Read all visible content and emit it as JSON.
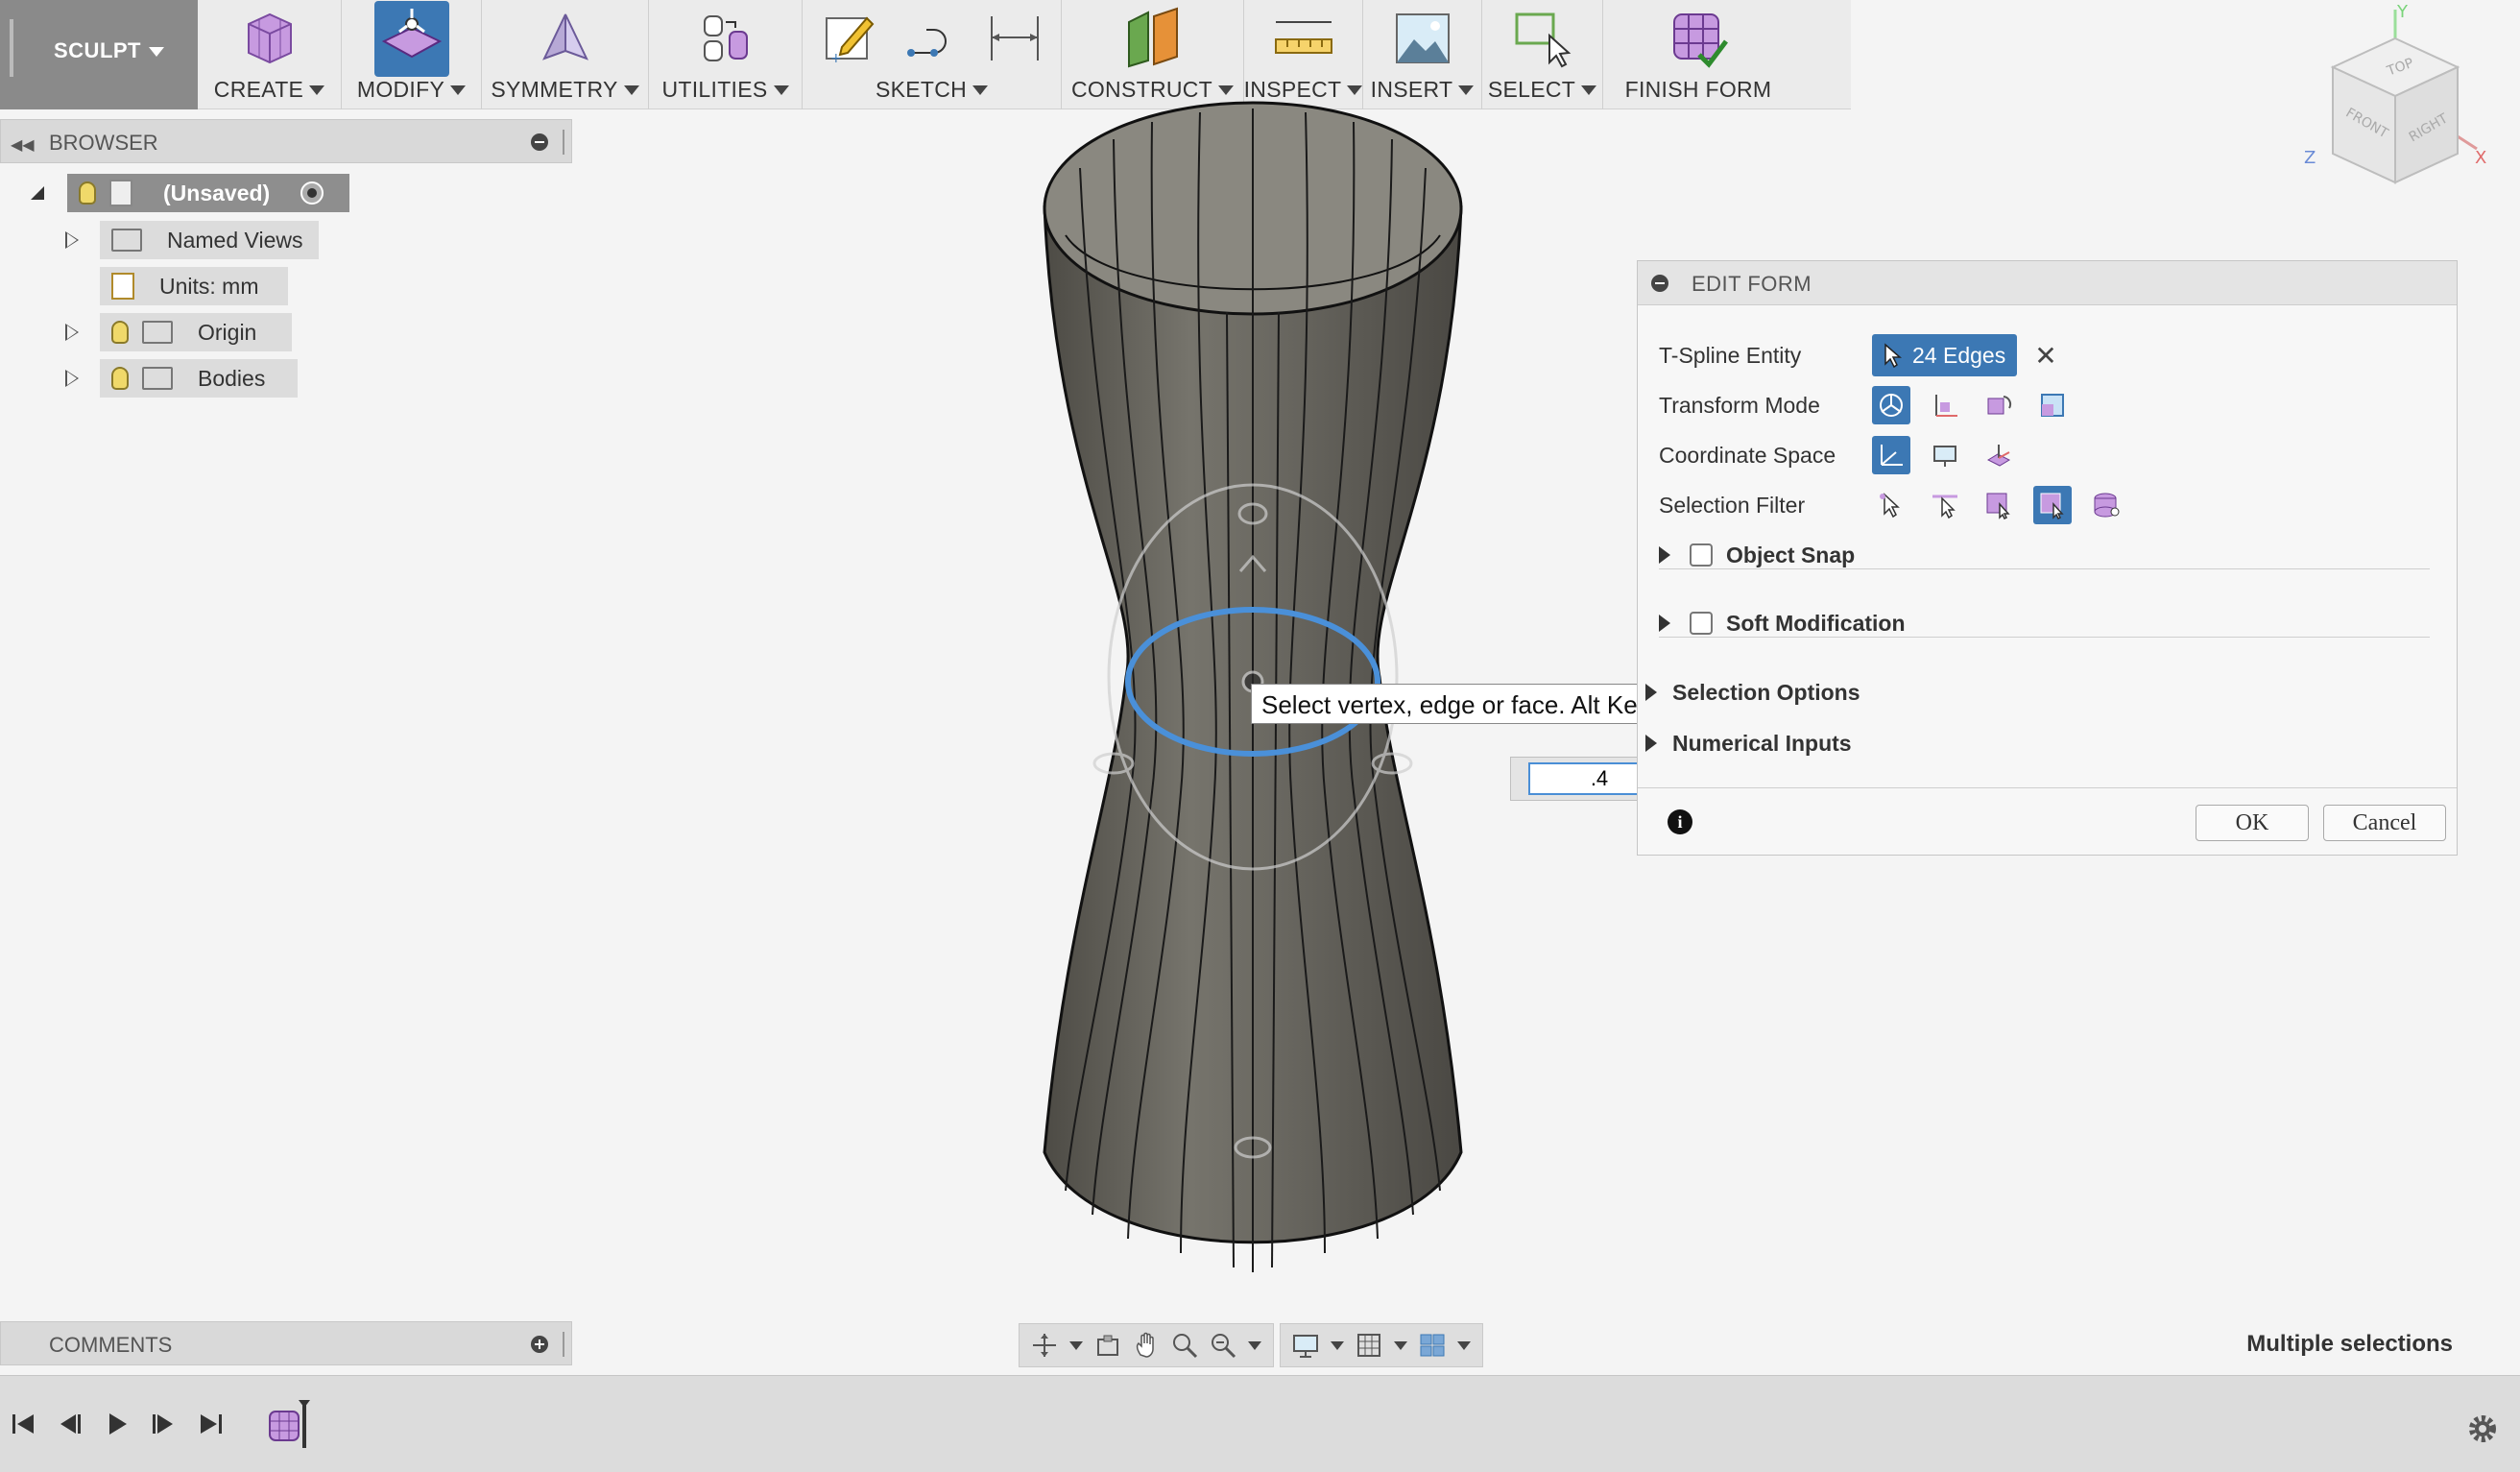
{
  "toolbar": {
    "workspace": "SCULPT",
    "groups": [
      {
        "label": "CREATE"
      },
      {
        "label": "MODIFY"
      },
      {
        "label": "SYMMETRY"
      },
      {
        "label": "UTILITIES"
      },
      {
        "label": "SKETCH"
      },
      {
        "label": "CONSTRUCT"
      },
      {
        "label": "INSPECT"
      },
      {
        "label": "INSERT"
      },
      {
        "label": "SELECT"
      },
      {
        "label": "FINISH FORM"
      }
    ]
  },
  "browser": {
    "title": "BROWSER",
    "items": [
      {
        "label": "(Unsaved)"
      },
      {
        "label": "Named Views"
      },
      {
        "label": "Units: mm"
      },
      {
        "label": "Origin"
      },
      {
        "label": "Bodies"
      }
    ]
  },
  "comments": {
    "title": "COMMENTS"
  },
  "viewcube": {
    "top": "TOP",
    "front": "FRONT",
    "right": "RIGHT",
    "x": "X",
    "y": "Y",
    "z": "Z"
  },
  "edit_form": {
    "title": "EDIT FORM",
    "tspline_label": "T-Spline Entity",
    "tspline_value": "24 Edges",
    "transform_label": "Transform Mode",
    "coordinate_label": "Coordinate Space",
    "filter_label": "Selection Filter",
    "object_snap": "Object Snap",
    "soft_modification": "Soft Modification",
    "selection_options": "Selection Options",
    "numerical_inputs": "Numerical Inputs",
    "ok": "OK",
    "cancel": "Cancel",
    "info": "i"
  },
  "viewport": {
    "tooltip": "Select vertex, edge or face. Alt Key to extrude",
    "input_value": ".4"
  },
  "status": {
    "text": "Multiple selections"
  },
  "colors": {
    "accent": "#3c78b4",
    "selection": "#4a90d9",
    "model": "#5e5c55"
  }
}
